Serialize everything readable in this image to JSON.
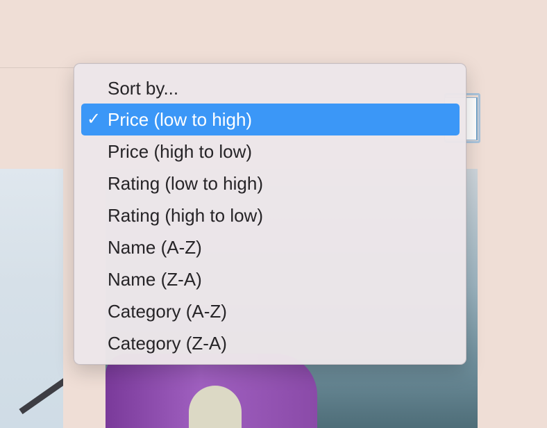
{
  "sort_menu": {
    "options": [
      {
        "label": "Sort by...",
        "checked": false,
        "highlighted": false
      },
      {
        "label": "Price (low to high)",
        "checked": true,
        "highlighted": true
      },
      {
        "label": "Price (high to low)",
        "checked": false,
        "highlighted": false
      },
      {
        "label": "Rating (low to high)",
        "checked": false,
        "highlighted": false
      },
      {
        "label": "Rating (high to low)",
        "checked": false,
        "highlighted": false
      },
      {
        "label": "Name (A-Z)",
        "checked": false,
        "highlighted": false
      },
      {
        "label": "Name (Z-A)",
        "checked": false,
        "highlighted": false
      },
      {
        "label": "Category (A-Z)",
        "checked": false,
        "highlighted": false
      },
      {
        "label": "Category (Z-A)",
        "checked": false,
        "highlighted": false
      }
    ],
    "checkmark_glyph": "✓",
    "highlight_color": "#3b97f7"
  },
  "colors": {
    "page_background": "#efded6",
    "menu_background": "#ece6e9",
    "menu_text": "#262427"
  }
}
